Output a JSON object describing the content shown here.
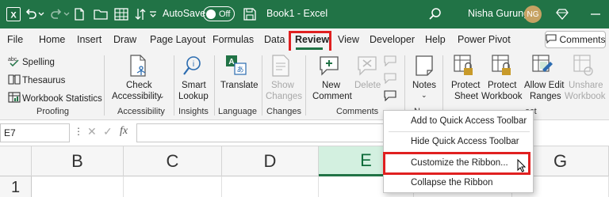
{
  "titlebar": {
    "autosave_label": "AutoSave",
    "toggle_state": "Off",
    "doc_title": "Book1 - Excel",
    "user_name": "Nisha Gurung",
    "user_initials": "NG",
    "color": "#217346"
  },
  "tabs": [
    "File",
    "Home",
    "Insert",
    "Draw",
    "Page Layout",
    "Formulas",
    "Data",
    "Review",
    "View",
    "Developer",
    "Help",
    "Power Pivot"
  ],
  "active_tab": "Review",
  "comments_button": "Comments",
  "ribbon": {
    "proofing": {
      "items": [
        "Spelling",
        "Thesaurus",
        "Workbook Statistics"
      ],
      "label": "Proofing"
    },
    "accessibility": {
      "button": [
        "Check",
        "Accessibility"
      ],
      "label": "Accessibility"
    },
    "insights": {
      "button": [
        "Smart",
        "Lookup"
      ],
      "label": "Insights"
    },
    "language": {
      "button": "Translate",
      "label": "Language"
    },
    "changes": {
      "button": [
        "Show",
        "Changes"
      ],
      "label": "Changes"
    },
    "comments": {
      "new": [
        "New",
        "Comment"
      ],
      "delete": "Delete",
      "label": "Comments"
    },
    "notes": {
      "button": "Notes",
      "label": "N"
    },
    "protect": {
      "sheet": [
        "Protect",
        "Sheet"
      ],
      "workbook": [
        "Protect",
        "Workbook"
      ],
      "ranges": [
        "Allow Edit",
        "Ranges"
      ],
      "unshare": [
        "Unshare",
        "Workbook"
      ],
      "label": "ect"
    }
  },
  "formula_bar": {
    "name_box": "E7",
    "fx": "fx"
  },
  "columns": [
    "B",
    "C",
    "D",
    "E",
    "G"
  ],
  "selected_column": "E",
  "rows": [
    "1"
  ],
  "context_menu": {
    "items": [
      "Add to Quick Access Toolbar",
      "Hide Quick Access Toolbar",
      "Customize the Ribbon...",
      "Collapse the Ribbon"
    ],
    "highlighted": "Customize the Ribbon..."
  }
}
